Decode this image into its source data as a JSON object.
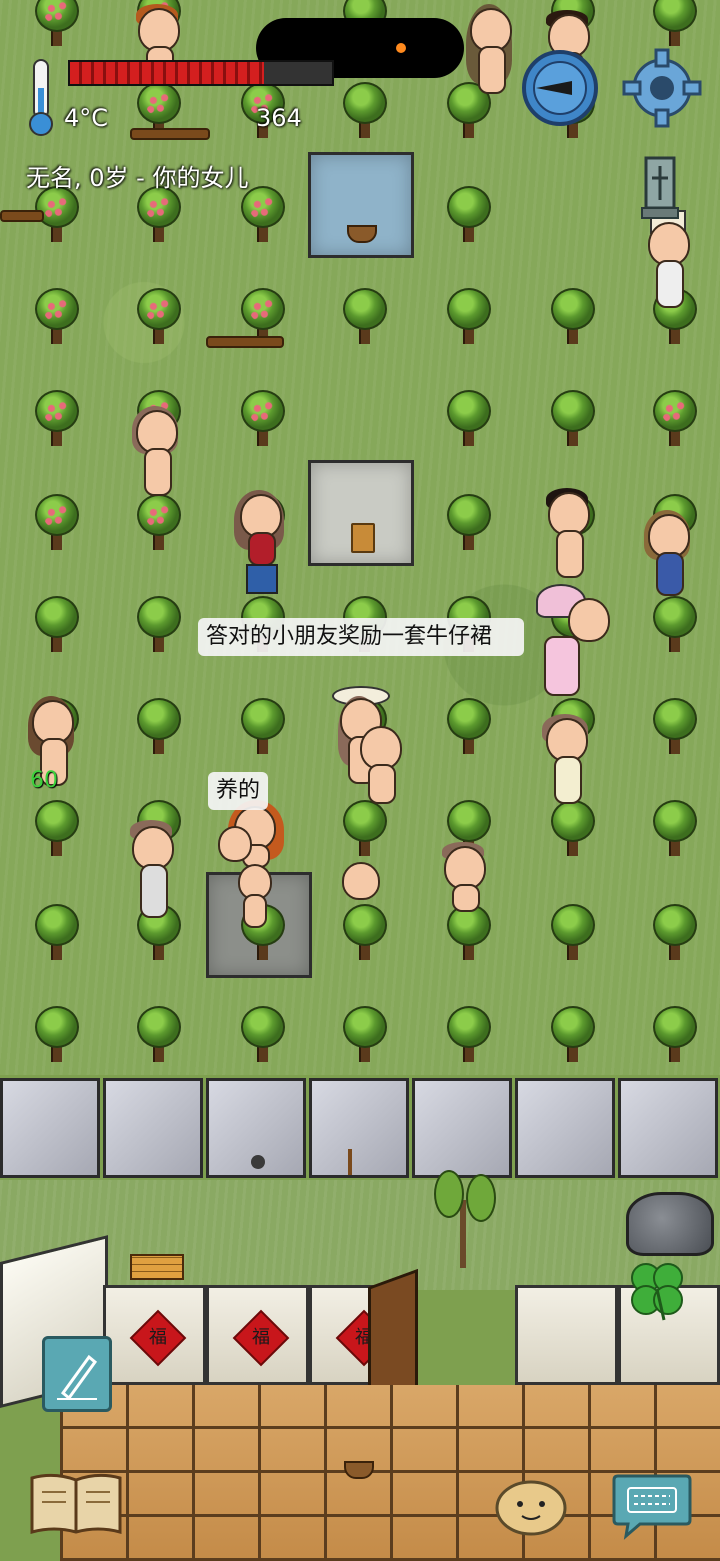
{
  "hud": {
    "temperature": "4°C",
    "food_count": "364",
    "food_fill": 0.74,
    "player_line": "无名, 0岁 - 你的女儿"
  },
  "speech": {
    "bubble_1": "答对的小朋友奖励一套牛仔裙",
    "bubble_2": "养的"
  },
  "markers": {
    "green_number": "60"
  },
  "decor": {
    "fu_char": "福"
  },
  "icons": {
    "thermometer": "thermometer-icon",
    "compass": "compass-icon",
    "settings": "gear-icon",
    "tech_tree": "tech-tree-icon",
    "pencil": "pencil-icon",
    "book": "book-icon",
    "emote": "emote-face-icon",
    "keyboard": "keyboard-chat-icon",
    "clover": "clover-icon"
  },
  "colors": {
    "food_bar": "#d41f1f",
    "grass": "#86a85a",
    "floor": "#c48b48",
    "fu_red": "#c8161b"
  }
}
